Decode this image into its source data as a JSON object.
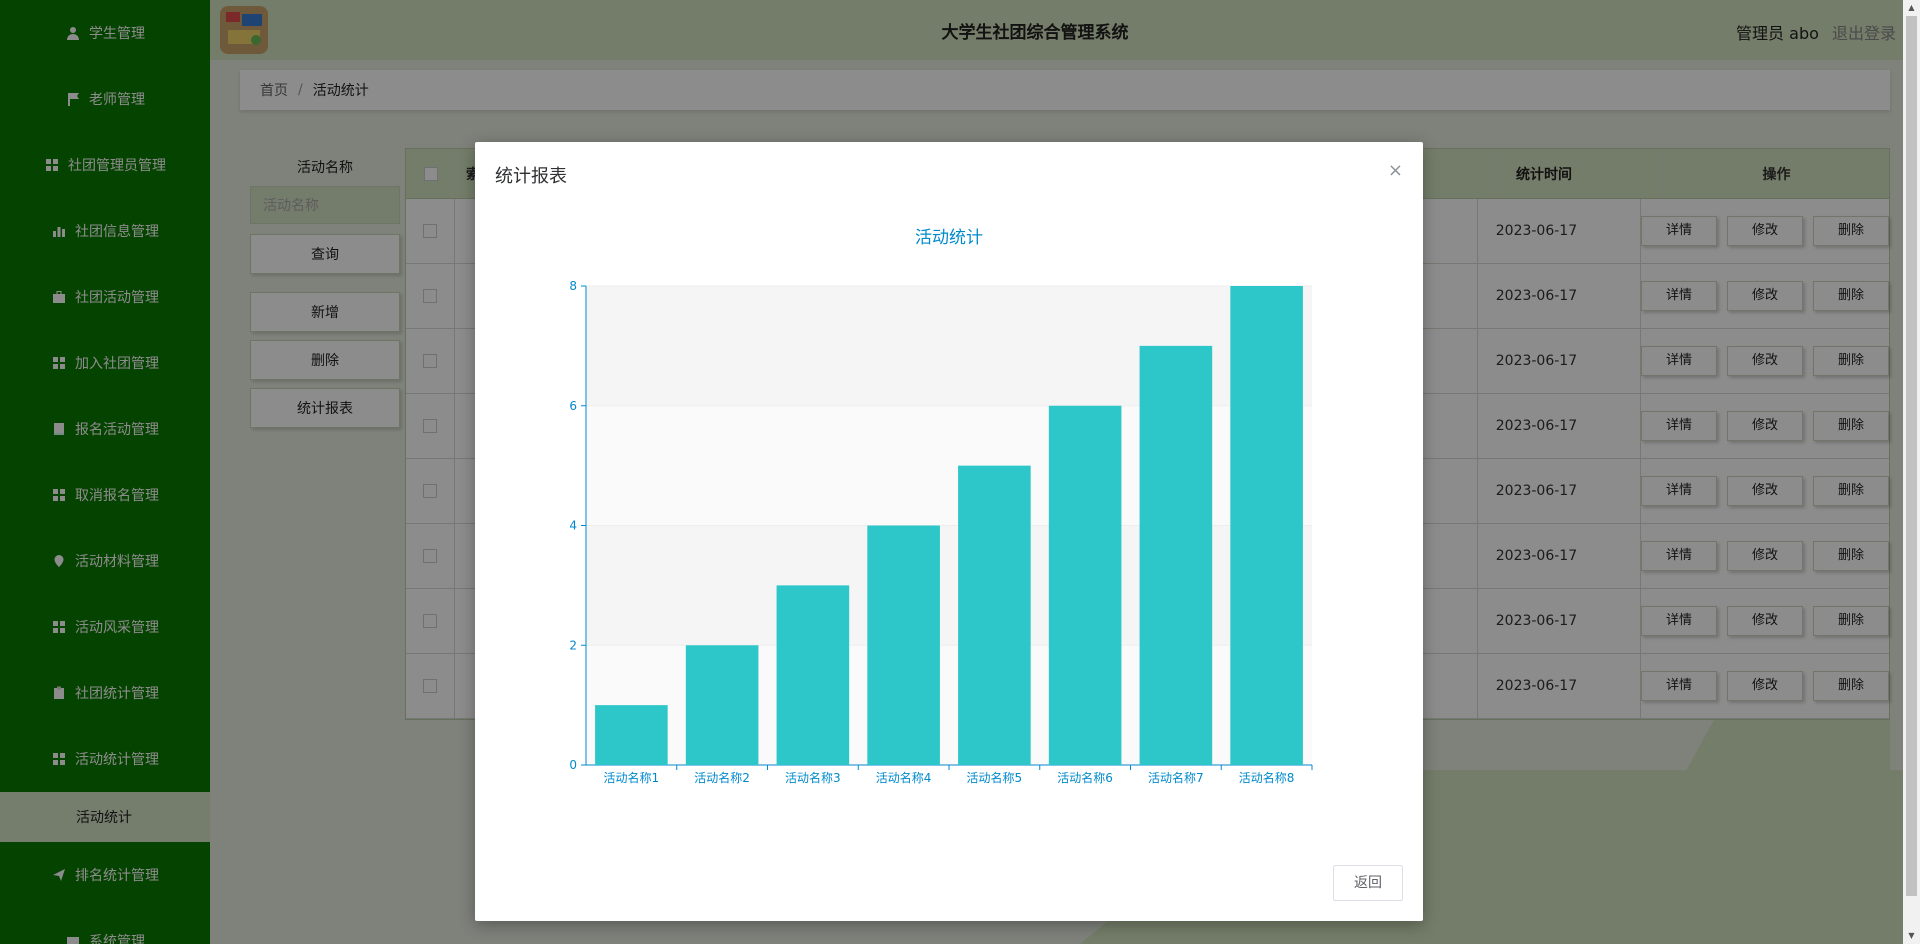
{
  "header": {
    "title": "大学生社团综合管理系统",
    "user": "管理员 abo",
    "logout": "退出登录"
  },
  "sidebar": {
    "items": [
      {
        "label": "学生管理",
        "icon": "user-icon"
      },
      {
        "label": "老师管理",
        "icon": "flag-icon"
      },
      {
        "label": "社团管理员管理",
        "icon": "grid-icon"
      },
      {
        "label": "社团信息管理",
        "icon": "bar-chart-icon"
      },
      {
        "label": "社团活动管理",
        "icon": "briefcase-icon"
      },
      {
        "label": "加入社团管理",
        "icon": "grid-icon"
      },
      {
        "label": "报名活动管理",
        "icon": "book-icon"
      },
      {
        "label": "取消报名管理",
        "icon": "grid-icon"
      },
      {
        "label": "活动材料管理",
        "icon": "location-icon"
      },
      {
        "label": "活动风采管理",
        "icon": "grid-icon"
      },
      {
        "label": "社团统计管理",
        "icon": "clipboard-icon"
      },
      {
        "label": "活动统计管理",
        "icon": "grid-icon"
      }
    ],
    "sub_item": "活动统计",
    "after_items": [
      {
        "label": "排名统计管理",
        "icon": "send-icon"
      },
      {
        "label": "系统管理",
        "icon": "ticket-icon"
      }
    ]
  },
  "breadcrumb": {
    "home": "首页",
    "sep": "/",
    "current": "活动统计"
  },
  "search": {
    "label": "活动名称",
    "placeholder": "活动名称",
    "query_btn": "查询",
    "add_btn": "新增",
    "delete_btn": "删除",
    "report_btn": "统计报表"
  },
  "table": {
    "headers": {
      "index": "索",
      "time": "统计时间",
      "ops": "操作"
    },
    "rows": [
      "2023-06-17",
      "2023-06-17",
      "2023-06-17",
      "2023-06-17",
      "2023-06-17",
      "2023-06-17",
      "2023-06-17",
      "2023-06-17"
    ],
    "ops": {
      "detail": "详情",
      "edit": "修改",
      "delete": "删除"
    }
  },
  "modal": {
    "title": "统计报表",
    "close": "×",
    "back_btn": "返回"
  },
  "colors": {
    "sidebar": "#0a7a00",
    "header": "#d3e3bf",
    "bar": "#2ec7c9",
    "axis": "#008acd"
  },
  "chart_data": {
    "type": "bar",
    "title": "活动统计",
    "categories": [
      "活动名称1",
      "活动名称2",
      "活动名称3",
      "活动名称4",
      "活动名称5",
      "活动名称6",
      "活动名称7",
      "活动名称8"
    ],
    "values": [
      1,
      2,
      3,
      4,
      5,
      6,
      7,
      8
    ],
    "ylim": [
      0,
      8
    ],
    "yticks": [
      0,
      2,
      4,
      6,
      8
    ],
    "grid": true
  }
}
